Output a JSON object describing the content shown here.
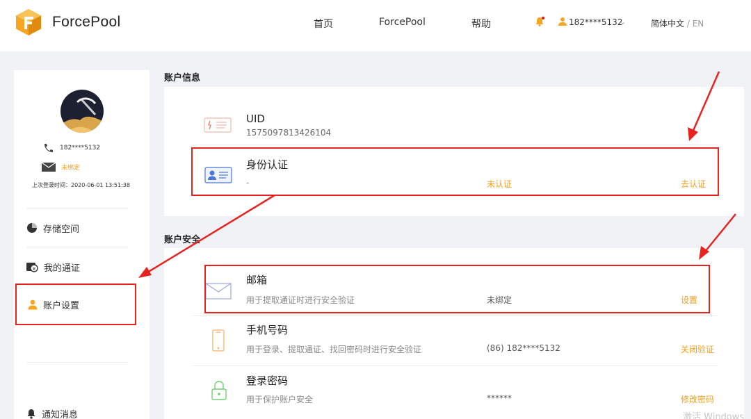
{
  "header": {
    "brand": "ForcePool",
    "nav": [
      "首页",
      "ForcePool",
      "帮助"
    ],
    "user_phone": "182****5132",
    "lang_cn": "简体中文",
    "lang_sep": " / ",
    "lang_en": "EN"
  },
  "sidebar": {
    "phone": "182****5132",
    "email_status": "未绑定",
    "last_login": "上次登录时间：2020-06-01 13:51:38",
    "menu": [
      "存储空间",
      "我的通证",
      "账户设置",
      "通知消息"
    ]
  },
  "account_info": {
    "title": "账户信息",
    "uid_label": "UID",
    "uid_value": "1575097813426104",
    "identity_label": "身份认证",
    "identity_value": "-",
    "identity_status": "未认证",
    "identity_action": "去认证"
  },
  "account_security": {
    "title": "账户安全",
    "rows": [
      {
        "label": "邮箱",
        "desc": "用于提取通证时进行安全验证",
        "status": "未绑定",
        "action": "设置"
      },
      {
        "label": "手机号码",
        "desc": "用于登录、提取通证、找回密码时进行安全验证",
        "status": "(86) 182****5132",
        "action": "关闭验证"
      },
      {
        "label": "登录密码",
        "desc": "用于保护账户安全",
        "status": "******",
        "action": "修改密码"
      }
    ]
  },
  "watermark": "激活 Windows",
  "colors": {
    "accent": "#f0a020",
    "highlight": "#e8221f",
    "identity_icon": "#4a78d6"
  }
}
